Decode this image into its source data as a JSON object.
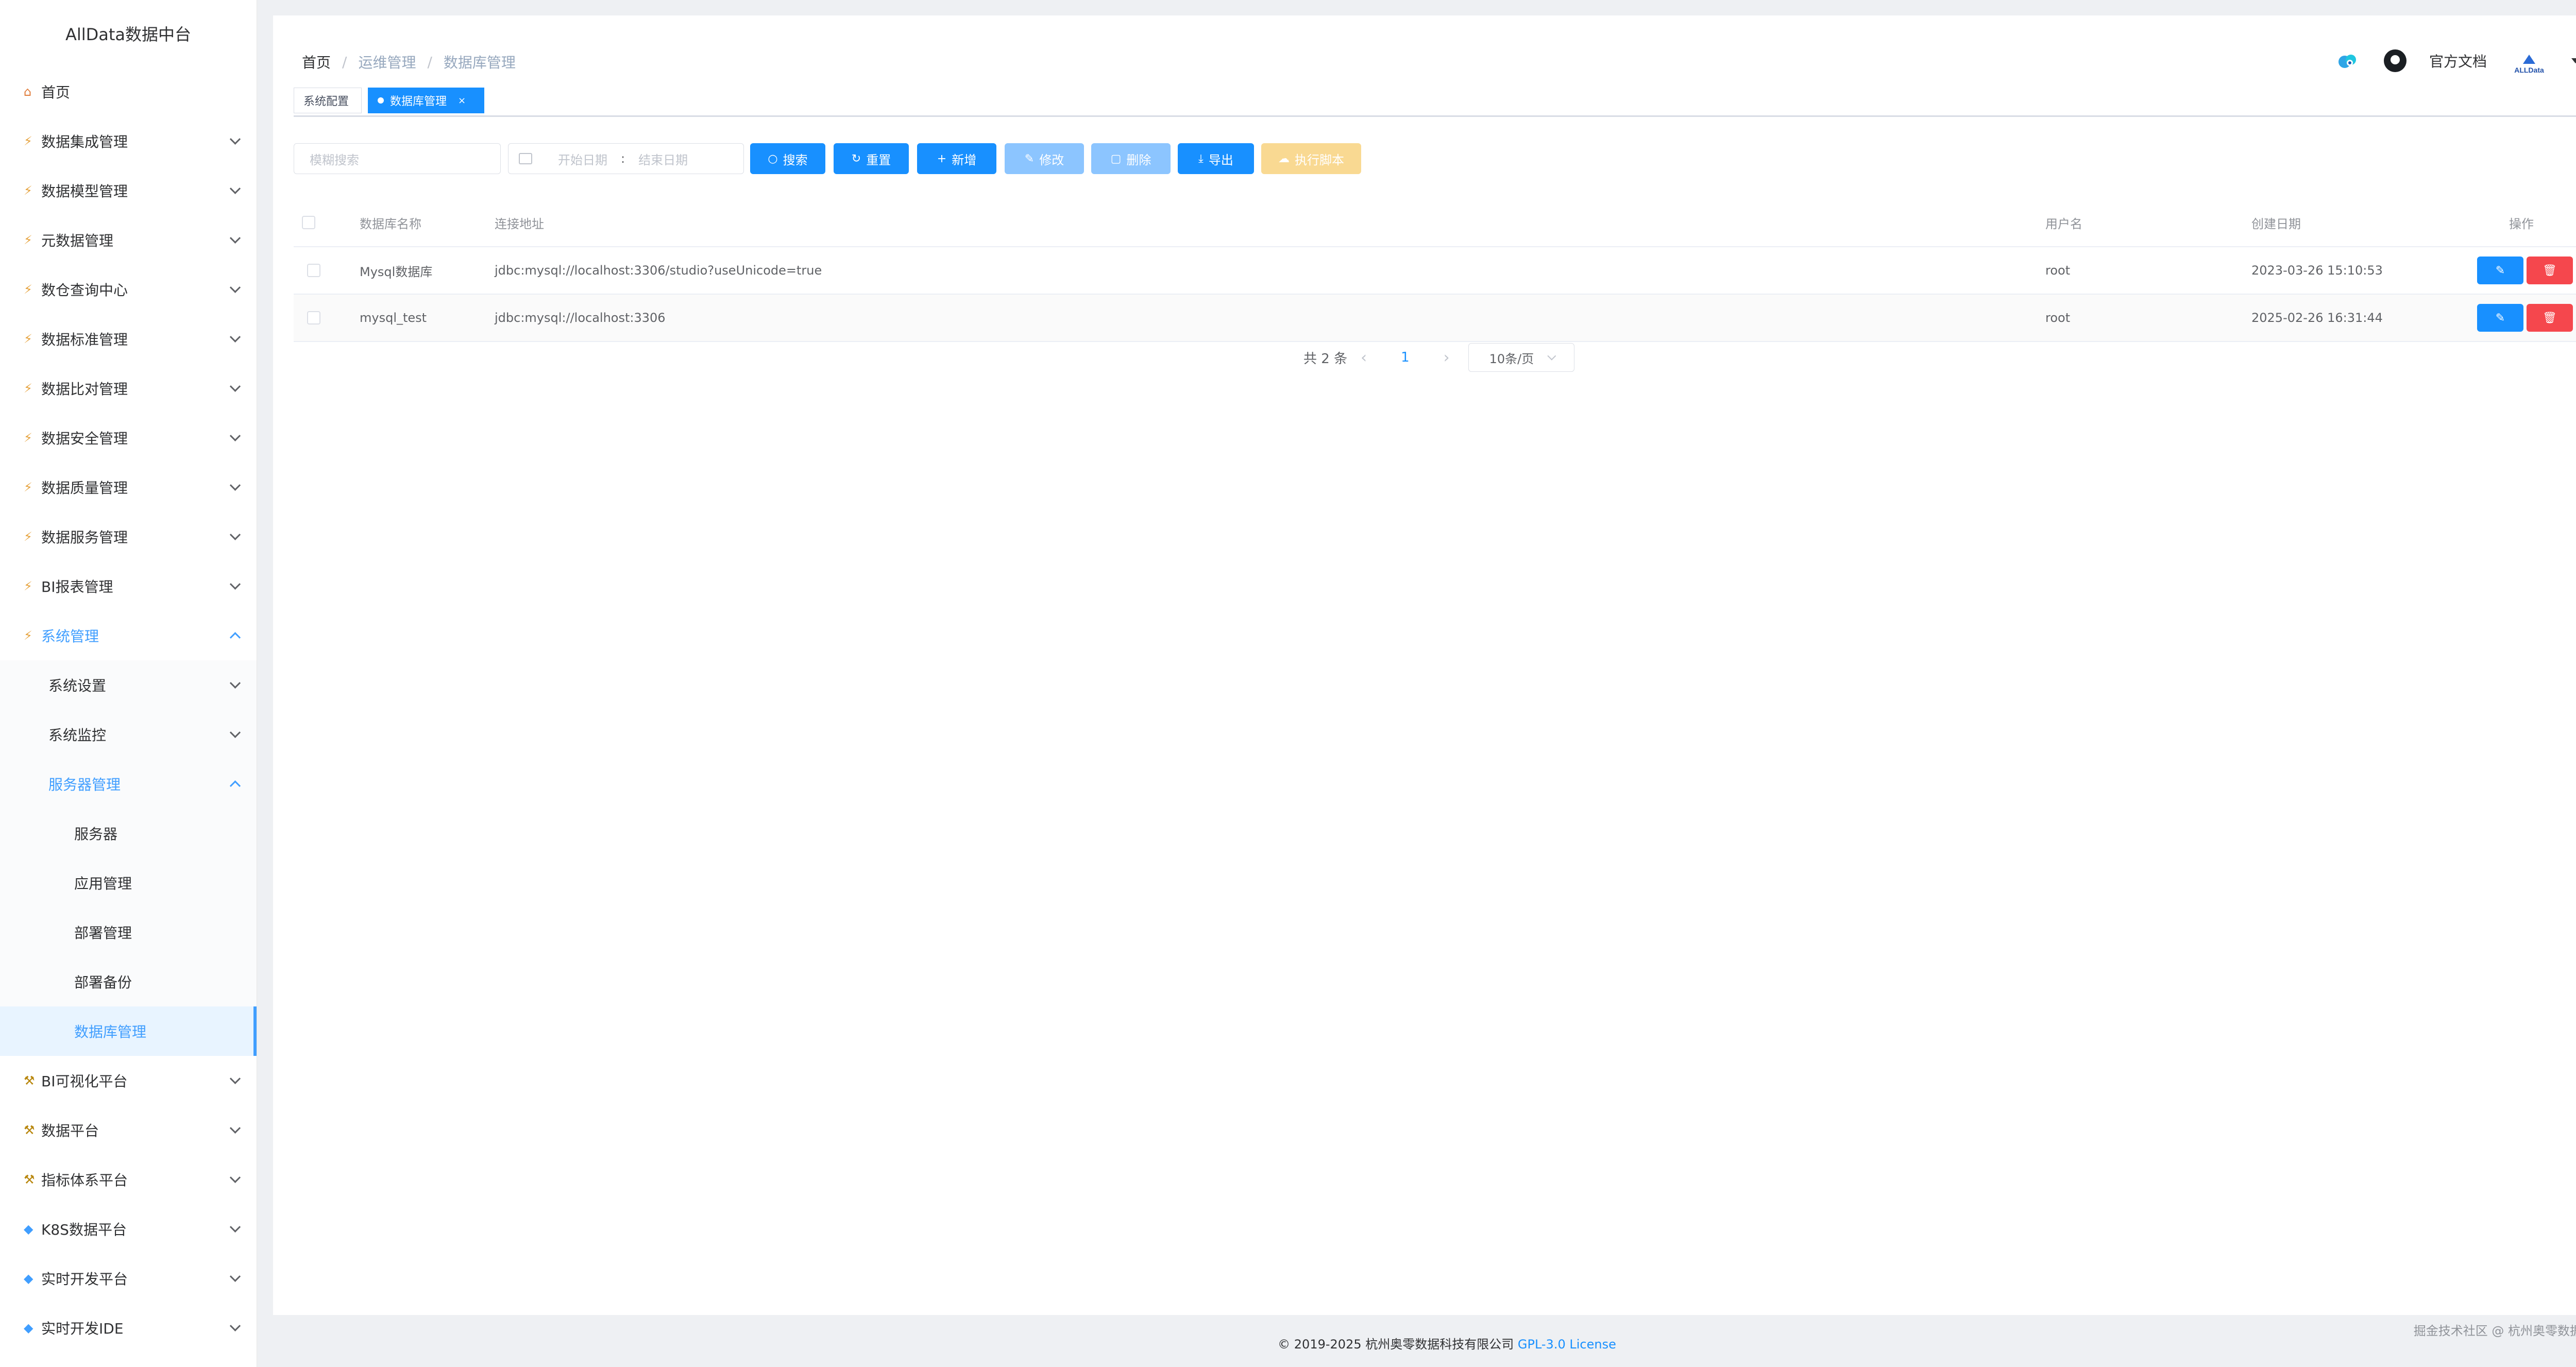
{
  "sidebar": {
    "brand": "AllData数据中台",
    "items": [
      {
        "label": "首页",
        "icon": "home-icon"
      },
      {
        "label": "数据集成管理",
        "icon": "lightning-icon"
      },
      {
        "label": "数据模型管理",
        "icon": "lightning-icon"
      },
      {
        "label": "元数据管理",
        "icon": "lightning-icon"
      },
      {
        "label": "数仓查询中心",
        "icon": "lightning-icon"
      },
      {
        "label": "数据标准管理",
        "icon": "lightning-icon"
      },
      {
        "label": "数据比对管理",
        "icon": "lightning-icon"
      },
      {
        "label": "数据安全管理",
        "icon": "lightning-icon"
      },
      {
        "label": "数据质量管理",
        "icon": "lightning-icon"
      },
      {
        "label": "数据服务管理",
        "icon": "lightning-icon"
      },
      {
        "label": "BI报表管理",
        "icon": "lightning-icon"
      },
      {
        "label": "系统管理",
        "icon": "lightning-icon"
      },
      {
        "label": "系统设置"
      },
      {
        "label": "系统监控"
      },
      {
        "label": "服务器管理"
      },
      {
        "label": "服务器"
      },
      {
        "label": "应用管理"
      },
      {
        "label": "部署管理"
      },
      {
        "label": "部署备份"
      },
      {
        "label": "数据库管理"
      },
      {
        "label": "BI可视化平台",
        "icon": "tool-icon"
      },
      {
        "label": "数据平台",
        "icon": "tool-icon"
      },
      {
        "label": "指标体系平台",
        "icon": "tool-icon"
      },
      {
        "label": "K8S数据平台",
        "icon": "gem-icon"
      },
      {
        "label": "实时开发平台",
        "icon": "gem-icon"
      },
      {
        "label": "实时开发IDE",
        "icon": "gem-icon"
      }
    ]
  },
  "header": {
    "breadcrumb": [
      "首页",
      "运维管理",
      "数据库管理"
    ],
    "docs_link": "官方文档",
    "avatar_text": "ALLData"
  },
  "tags": [
    {
      "label": "系统配置",
      "active": false
    },
    {
      "label": "数据库管理",
      "active": true,
      "close": "×"
    }
  ],
  "toolbar": {
    "search_placeholder": "模糊搜索",
    "start_date_placeholder": "开始日期",
    "date_separator": ":",
    "end_date_placeholder": "结束日期",
    "search": "搜索",
    "reset": "重置",
    "add": "新增",
    "edit": "修改",
    "delete": "删除",
    "export": "导出",
    "run_script": "执行脚本"
  },
  "table": {
    "columns": [
      "数据库名称",
      "连接地址",
      "用户名",
      "创建日期",
      "操作"
    ],
    "rows": [
      {
        "name": "Mysql数据库",
        "url": "jdbc:mysql://localhost:3306/studio?useUnicode=true",
        "user": "root",
        "created": "2023-03-26 15:10:53"
      },
      {
        "name": "mysql_test",
        "url": "jdbc:mysql://localhost:3306",
        "user": "root",
        "created": "2025-02-26 16:31:44"
      }
    ]
  },
  "pagination": {
    "total": "共 2 条",
    "current": "1",
    "page_size": "10条/页"
  },
  "footer": {
    "copyright": "© 2019-2025 杭州奥零数据科技有限公司",
    "license": "GPL-3.0 License",
    "watermark": "掘金技术社区 @ 杭州奥零数据科技"
  },
  "colors": {
    "primary": "#1890ff",
    "danger": "#f5474d",
    "warning_disabled": "#f9d992",
    "sidebar_active_bg": "#e8f4ff"
  }
}
